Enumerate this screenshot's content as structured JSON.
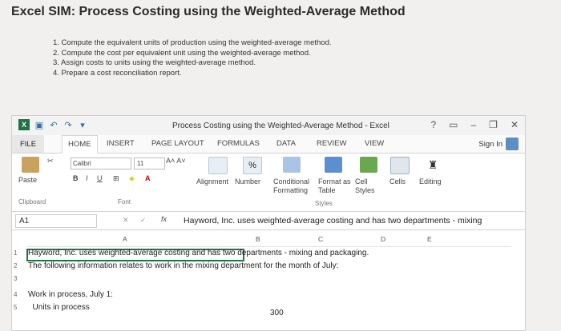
{
  "page": {
    "title": "Excel SIM: Process Costing using the Weighted-Average Method",
    "instructions": [
      "1. Compute the equivalent units of production using the weighted-average method.",
      "2. Compute the cost per equivalent unit using the weighted-average method.",
      "3. Assign costs to units using the weighted-average method.",
      "4. Prepare a cost reconciliation report."
    ]
  },
  "excel": {
    "window_title": "Process Costing using the Weighted-Average Method - Excel",
    "tabs": [
      "FILE",
      "HOME",
      "INSERT",
      "PAGE LAYOUT",
      "FORMULAS",
      "DATA",
      "REVIEW",
      "VIEW"
    ],
    "active_tab": "HOME",
    "sign_in": "Sign In",
    "ribbon": {
      "paste": "Paste",
      "clipboard": "Clipboard",
      "font_name": "Calibri",
      "font_size": "11",
      "font_group": "Font",
      "alignment": "Alignment",
      "number": "Number",
      "conditional_formatting": "Conditional Formatting",
      "format_as_table": "Format as Table",
      "cell_styles": "Cell Styles",
      "styles_group": "Styles",
      "cells": "Cells",
      "editing": "Editing"
    },
    "name_box": "A1",
    "formula": "Hayword, Inc. uses weighted-average costing and has two departments - mixing",
    "columns": [
      "A",
      "B",
      "C",
      "D",
      "E"
    ],
    "rows": [
      {
        "num": "1",
        "text": "Hayword, Inc. uses weighted-average costing and has two departments - mixing and packaging."
      },
      {
        "num": "2",
        "text": "The following information relates to work in the mixing department for the month of July:"
      },
      {
        "num": "3",
        "text": ""
      },
      {
        "num": "4",
        "text": "Work in process, July 1:"
      },
      {
        "num": "5",
        "text": "  Units in process",
        "value": "300"
      }
    ]
  }
}
